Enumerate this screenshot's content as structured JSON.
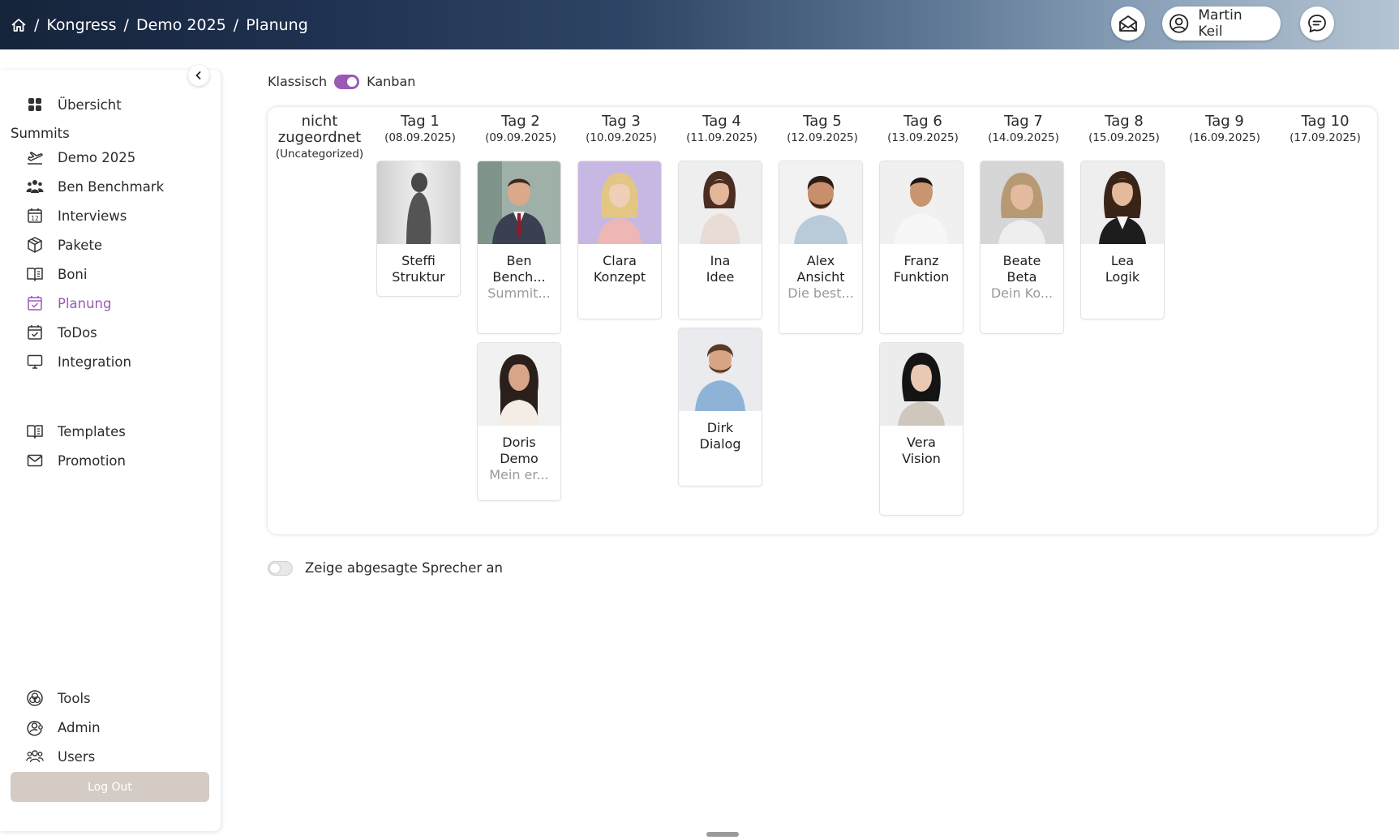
{
  "breadcrumb": {
    "home_icon": "home-icon",
    "items": [
      "Kongress",
      "Demo 2025",
      "Planung"
    ]
  },
  "header": {
    "mail_icon": "envelope-open-icon",
    "user_name": "Martin Keil",
    "user_icon": "user-circle-icon",
    "chat_icon": "chat-bubble-icon"
  },
  "sidebar": {
    "collapse_icon": "chevron-left-icon",
    "overview": "Übersicht",
    "section_label": "Summits",
    "items": [
      {
        "label": "Demo 2025",
        "icon": "plane-takeoff-icon"
      },
      {
        "label": "Ben Benchmark",
        "icon": "people-group-icon"
      },
      {
        "label": "Interviews",
        "icon": "calendar-12-icon"
      },
      {
        "label": "Pakete",
        "icon": "package-box-icon"
      },
      {
        "label": "Boni",
        "icon": "open-book-icon"
      },
      {
        "label": "Planung",
        "icon": "calendar-check-icon",
        "active": true
      },
      {
        "label": "ToDos",
        "icon": "calendar-todo-icon"
      },
      {
        "label": "Integration",
        "icon": "monitor-icon"
      }
    ],
    "extras": [
      {
        "label": "Templates",
        "icon": "open-book-icon"
      },
      {
        "label": "Promotion",
        "icon": "envelope-icon"
      }
    ],
    "bottom": [
      {
        "label": "Tools",
        "icon": "tools-circles-icon"
      },
      {
        "label": "Admin",
        "icon": "admin-user-gear-icon"
      },
      {
        "label": "Users",
        "icon": "users-icon"
      }
    ],
    "logout": "Log Out"
  },
  "view_toggle": {
    "left": "Klassisch",
    "right": "Kanban"
  },
  "board": {
    "columns": [
      {
        "title": "nicht zugeordnet",
        "sub": "(Uncategorized)"
      },
      {
        "title": "Tag 1",
        "sub": "(08.09.2025)"
      },
      {
        "title": "Tag 2",
        "sub": "(09.09.2025)"
      },
      {
        "title": "Tag 3",
        "sub": "(10.09.2025)"
      },
      {
        "title": "Tag 4",
        "sub": "(11.09.2025)"
      },
      {
        "title": "Tag 5",
        "sub": "(12.09.2025)"
      },
      {
        "title": "Tag 6",
        "sub": "(13.09.2025)"
      },
      {
        "title": "Tag 7",
        "sub": "(14.09.2025)"
      },
      {
        "title": "Tag 8",
        "sub": "(15.09.2025)"
      },
      {
        "title": "Tag 9",
        "sub": "(16.09.2025)"
      },
      {
        "title": "Tag 10",
        "sub": "(17.09.2025)"
      }
    ],
    "cards": [
      {
        "first": "Steffi",
        "last": "Struktur",
        "sub": ""
      },
      {
        "first": "Ben",
        "last": "Bench...",
        "sub": "Summit..."
      },
      {
        "first": "Doris",
        "last": "Demo",
        "sub": "Mein er..."
      },
      {
        "first": "Clara",
        "last": "Konzept",
        "sub": ""
      },
      {
        "first": "Ina",
        "last": "Idee",
        "sub": ""
      },
      {
        "first": "Dirk",
        "last": "Dialog",
        "sub": ""
      },
      {
        "first": "Alex",
        "last": "Ansicht",
        "sub": "Die best..."
      },
      {
        "first": "Franz",
        "last": "Funktion",
        "sub": ""
      },
      {
        "first": "Vera",
        "last": "Vision",
        "sub": ""
      },
      {
        "first": "Beate",
        "last": "Beta",
        "sub": "Dein Ko..."
      },
      {
        "first": "Lea",
        "last": "Logik",
        "sub": ""
      }
    ]
  },
  "cancelled_toggle": "Zeige abgesagte Sprecher an",
  "colors": {
    "accent": "#9b59b6",
    "logout_bg": "#d4cbc5"
  }
}
